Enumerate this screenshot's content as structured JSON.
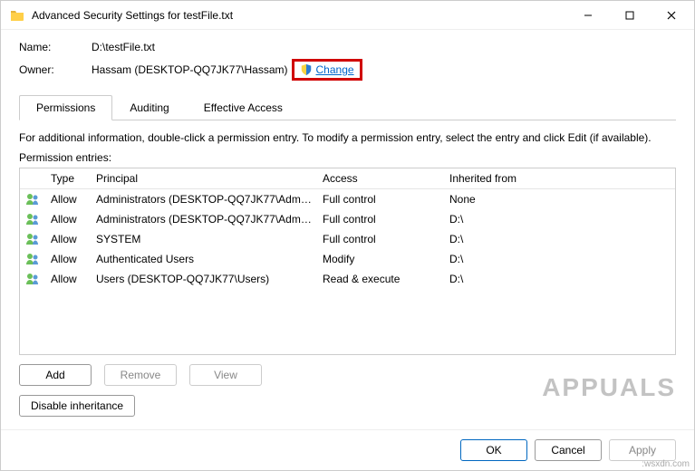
{
  "titlebar": {
    "title": "Advanced Security Settings for testFile.txt"
  },
  "header": {
    "name_label": "Name:",
    "name_value": "D:\\testFile.txt",
    "owner_label": "Owner:",
    "owner_value": "Hassam (DESKTOP-QQ7JK77\\Hassam)",
    "change_label": "Change"
  },
  "tabs": [
    {
      "label": "Permissions",
      "active": true
    },
    {
      "label": "Auditing",
      "active": false
    },
    {
      "label": "Effective Access",
      "active": false
    }
  ],
  "info_text": "For additional information, double-click a permission entry. To modify a permission entry, select the entry and click Edit (if available).",
  "entries_label": "Permission entries:",
  "columns": {
    "type": "Type",
    "principal": "Principal",
    "access": "Access",
    "inherited": "Inherited from"
  },
  "entries": [
    {
      "type": "Allow",
      "principal": "Administrators (DESKTOP-QQ7JK77\\Admini...",
      "access": "Full control",
      "inherited": "None"
    },
    {
      "type": "Allow",
      "principal": "Administrators (DESKTOP-QQ7JK77\\Admini...",
      "access": "Full control",
      "inherited": "D:\\"
    },
    {
      "type": "Allow",
      "principal": "SYSTEM",
      "access": "Full control",
      "inherited": "D:\\"
    },
    {
      "type": "Allow",
      "principal": "Authenticated Users",
      "access": "Modify",
      "inherited": "D:\\"
    },
    {
      "type": "Allow",
      "principal": "Users (DESKTOP-QQ7JK77\\Users)",
      "access": "Read & execute",
      "inherited": "D:\\"
    }
  ],
  "buttons": {
    "add": "Add",
    "remove": "Remove",
    "view": "View",
    "disable_inheritance": "Disable inheritance",
    "ok": "OK",
    "cancel": "Cancel",
    "apply": "Apply"
  },
  "watermark": "APPUALS",
  "wsx": ":wsxdn.com"
}
